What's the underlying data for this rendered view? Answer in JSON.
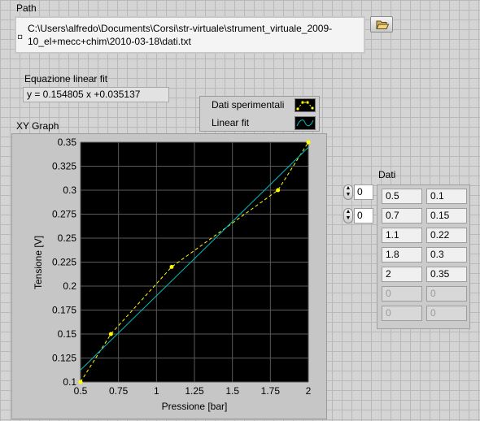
{
  "path": {
    "label": "Path",
    "line1": "C:\\Users\\alfredo\\Documents\\Corsi\\str-virtuale\\strument_virtuale_2009-",
    "line2": "10_el+mecc+chim\\2010-03-18\\dati.txt",
    "browse_icon": "folder-open-icon"
  },
  "equation": {
    "label": "Equazione linear fit",
    "value": "y = 0.154805 x +0.035137"
  },
  "legend": {
    "items": [
      {
        "label": "Dati sperimentali"
      },
      {
        "label": "Linear fit"
      }
    ]
  },
  "graph": {
    "label": "XY Graph"
  },
  "chart_data": {
    "type": "line",
    "xlabel": "Pressione [bar]",
    "ylabel": "Tensione [V]",
    "xlim": [
      0.5,
      2
    ],
    "ylim": [
      0.1,
      0.35
    ],
    "xticks": [
      "0.5",
      "0.75",
      "1",
      "1.25",
      "1.5",
      "1.75",
      "2"
    ],
    "yticks": [
      "0.1",
      "0.125",
      "0.15",
      "0.175",
      "0.2",
      "0.225",
      "0.25",
      "0.275",
      "0.3",
      "0.325",
      "0.35"
    ],
    "grid": true,
    "series": [
      {
        "name": "Dati sperimentali",
        "style": "dashed",
        "color": "#ffff00",
        "x": [
          0.5,
          0.7,
          1.1,
          1.8,
          2
        ],
        "y": [
          0.1,
          0.15,
          0.22,
          0.3,
          0.35
        ]
      },
      {
        "name": "Linear fit",
        "style": "solid",
        "color": "#00bcbc",
        "x": [
          0.5,
          2
        ],
        "y": [
          0.1125,
          0.3447
        ]
      }
    ]
  },
  "data_array": {
    "label": "Dati",
    "row_index": "0",
    "col_index": "0",
    "rows": [
      [
        "0.5",
        "0.1"
      ],
      [
        "0.7",
        "0.15"
      ],
      [
        "1.1",
        "0.22"
      ],
      [
        "1.8",
        "0.3"
      ],
      [
        "2",
        "0.35"
      ],
      [
        "0",
        "0"
      ],
      [
        "0",
        "0"
      ]
    ],
    "active_rows": 5
  },
  "colors": {
    "plot_bg": "#000000",
    "grid": "#5a5a5a",
    "data_series": "#ffff00",
    "fit_series": "#00bcbc"
  }
}
